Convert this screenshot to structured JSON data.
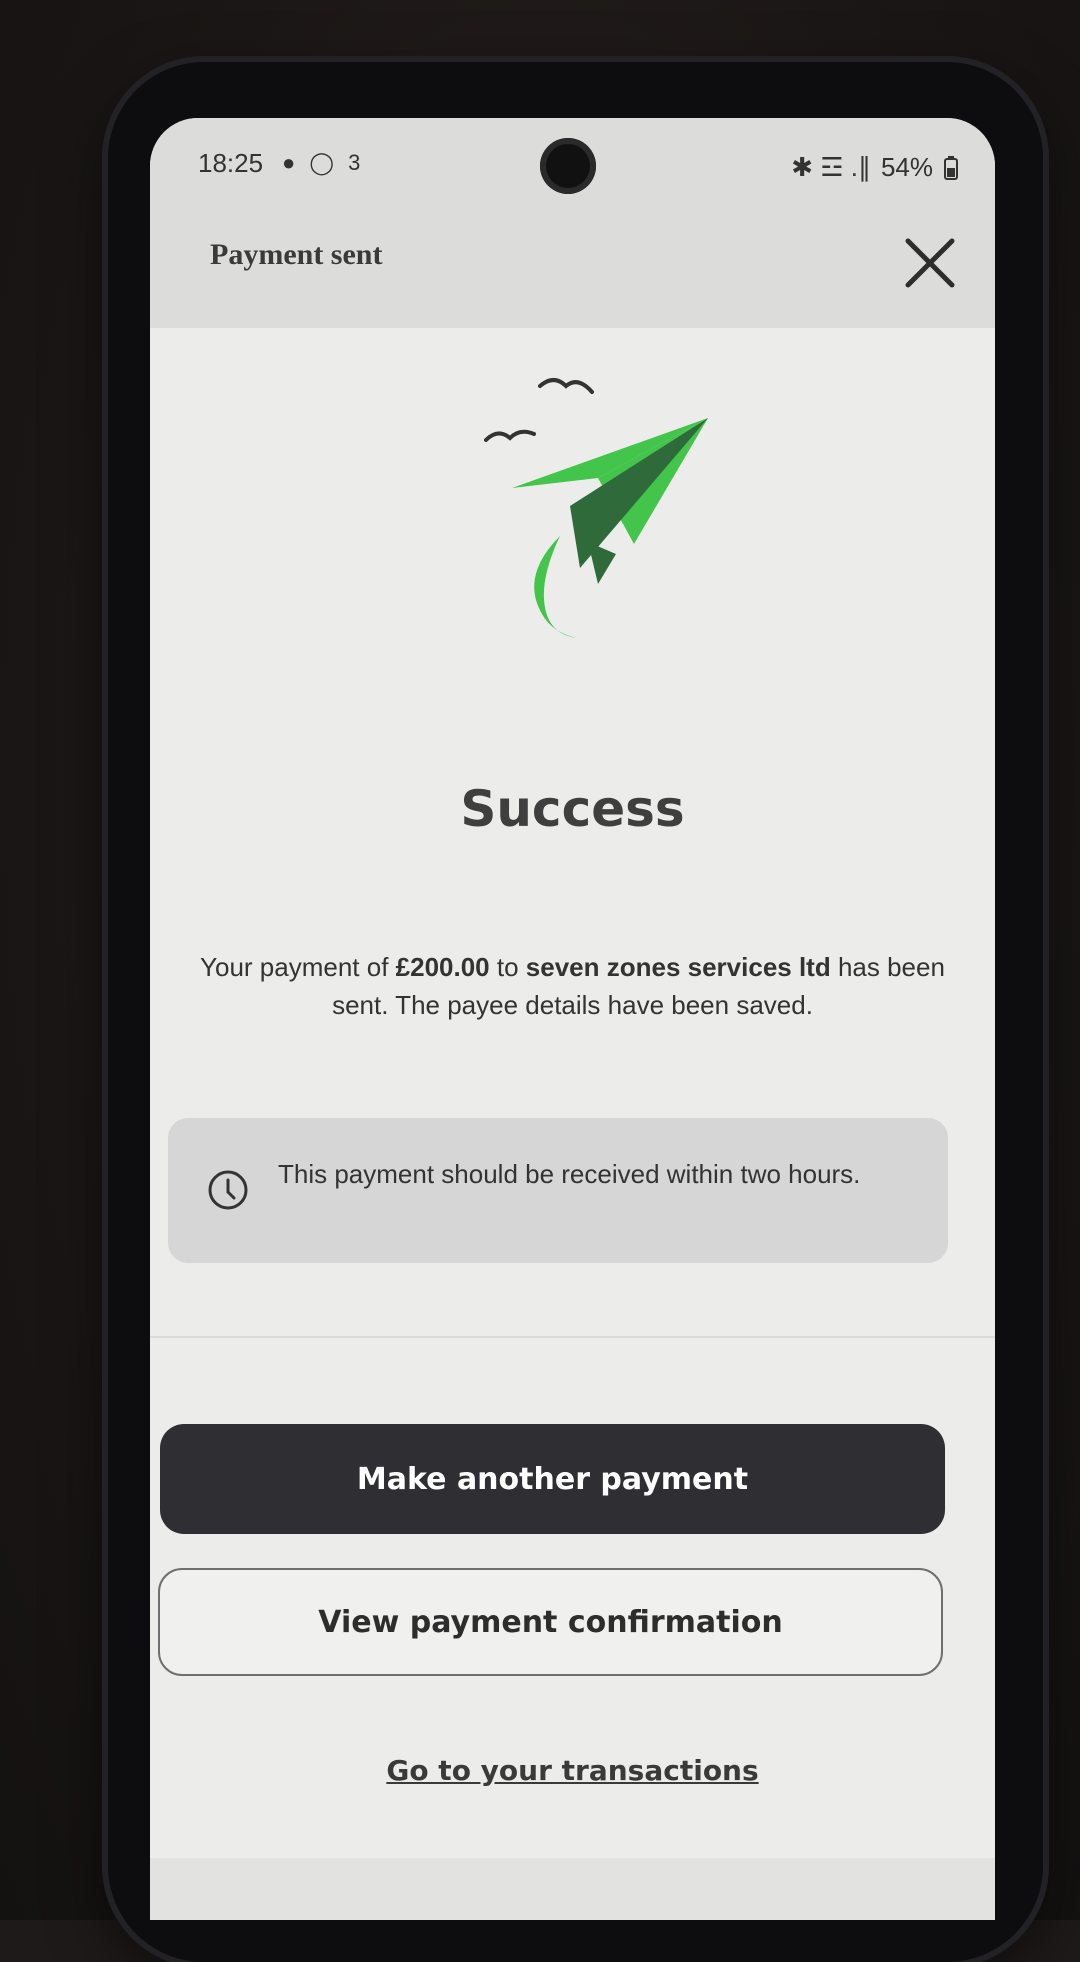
{
  "status_bar": {
    "time": "18:25",
    "notifications": "● ◯ 3",
    "battery": "54%",
    "signal": "✱ ☲ .∥"
  },
  "header": {
    "title": "Payment sent",
    "close_icon": "close-icon"
  },
  "illustration": {
    "icon": "paper-plane-icon",
    "colors": {
      "plane_light": "#43c44a",
      "plane_dark": "#2f6b3a",
      "birds": "#333333"
    }
  },
  "main": {
    "title": "Success",
    "message_prefix": "Your payment of ",
    "amount": "£200.00",
    "message_mid": " to ",
    "payee": "seven zones services ltd",
    "message_suffix": " has been sent. The payee details have been saved.",
    "info_text": "This payment should be received within two hours.",
    "info_icon": "clock-icon"
  },
  "actions": {
    "primary_label": "Make another payment",
    "secondary_label": "View payment confirmation",
    "link_label": "Go to your transactions"
  },
  "colors": {
    "primary_button": "#2f2e33",
    "background": "#ececea",
    "accent_green": "#43c44a"
  }
}
